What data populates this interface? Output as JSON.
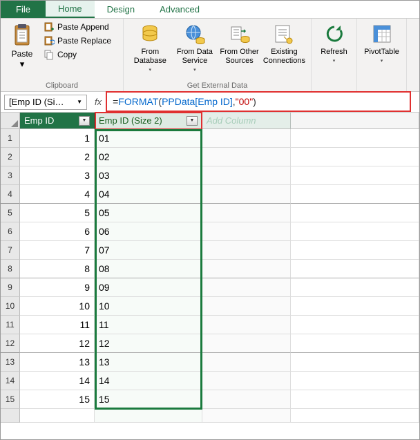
{
  "tabs": {
    "file": "File",
    "home": "Home",
    "design": "Design",
    "advanced": "Advanced"
  },
  "ribbon": {
    "clipboard": {
      "paste": "Paste",
      "paste_append": "Paste Append",
      "paste_replace": "Paste Replace",
      "copy": "Copy",
      "group": "Clipboard"
    },
    "getdata": {
      "from_db": "From\nDatabase",
      "from_svc": "From Data\nService",
      "from_other": "From Other\nSources",
      "existing": "Existing\nConnections",
      "group": "Get External Data"
    },
    "refresh": "Refresh",
    "pivot": "PivotTable"
  },
  "namebox": "[Emp ID (Si…",
  "fx_label": "fx",
  "formula": {
    "fn": "FORMAT",
    "arg1": "PPData[Emp ID]",
    "arg2": "\"00\""
  },
  "columns": {
    "c1": "Emp ID",
    "c2": "Emp ID (Size 2)",
    "c3": "Add Column"
  },
  "chart_data": {
    "type": "table",
    "columns": [
      "Emp ID",
      "Emp ID (Size 2)"
    ],
    "rows": [
      {
        "emp_id": 1,
        "emp_id_size2": "01"
      },
      {
        "emp_id": 2,
        "emp_id_size2": "02"
      },
      {
        "emp_id": 3,
        "emp_id_size2": "03"
      },
      {
        "emp_id": 4,
        "emp_id_size2": "04"
      },
      {
        "emp_id": 5,
        "emp_id_size2": "05"
      },
      {
        "emp_id": 6,
        "emp_id_size2": "06"
      },
      {
        "emp_id": 7,
        "emp_id_size2": "07"
      },
      {
        "emp_id": 8,
        "emp_id_size2": "08"
      },
      {
        "emp_id": 9,
        "emp_id_size2": "09"
      },
      {
        "emp_id": 10,
        "emp_id_size2": "10"
      },
      {
        "emp_id": 11,
        "emp_id_size2": "11"
      },
      {
        "emp_id": 12,
        "emp_id_size2": "12"
      },
      {
        "emp_id": 13,
        "emp_id_size2": "13"
      },
      {
        "emp_id": 14,
        "emp_id_size2": "14"
      },
      {
        "emp_id": 15,
        "emp_id_size2": "15"
      }
    ]
  }
}
